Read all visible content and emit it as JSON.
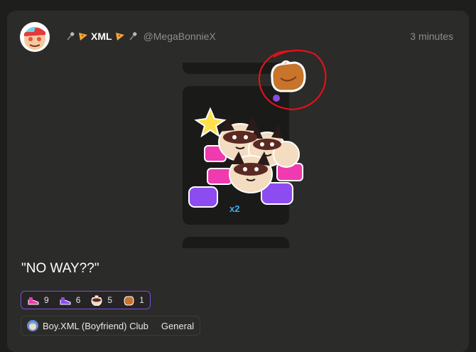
{
  "post": {
    "author_display_name": "XML",
    "author_handle": "@MegaBonnieX",
    "timestamp": "3 minutes",
    "text": "\"NO WAY??\"",
    "sticker_count": "x2",
    "name_icons": [
      "microphone-icon",
      "pizza-icon",
      "pizza-icon",
      "microphone-icon"
    ]
  },
  "reactions": [
    {
      "icon": "pink-slipper-icon",
      "count": "9"
    },
    {
      "icon": "purple-slipper-icon",
      "count": "6"
    },
    {
      "icon": "raccoon-face-icon",
      "count": "5"
    },
    {
      "icon": "brown-bag-icon",
      "count": "1"
    }
  ],
  "club": {
    "name": "Boy.XML (Boyfriend) Club",
    "channel": "General"
  },
  "colors": {
    "accent": "#7b4fe0",
    "annotation": "#e0121b",
    "count_blue": "#3fa9f5"
  }
}
